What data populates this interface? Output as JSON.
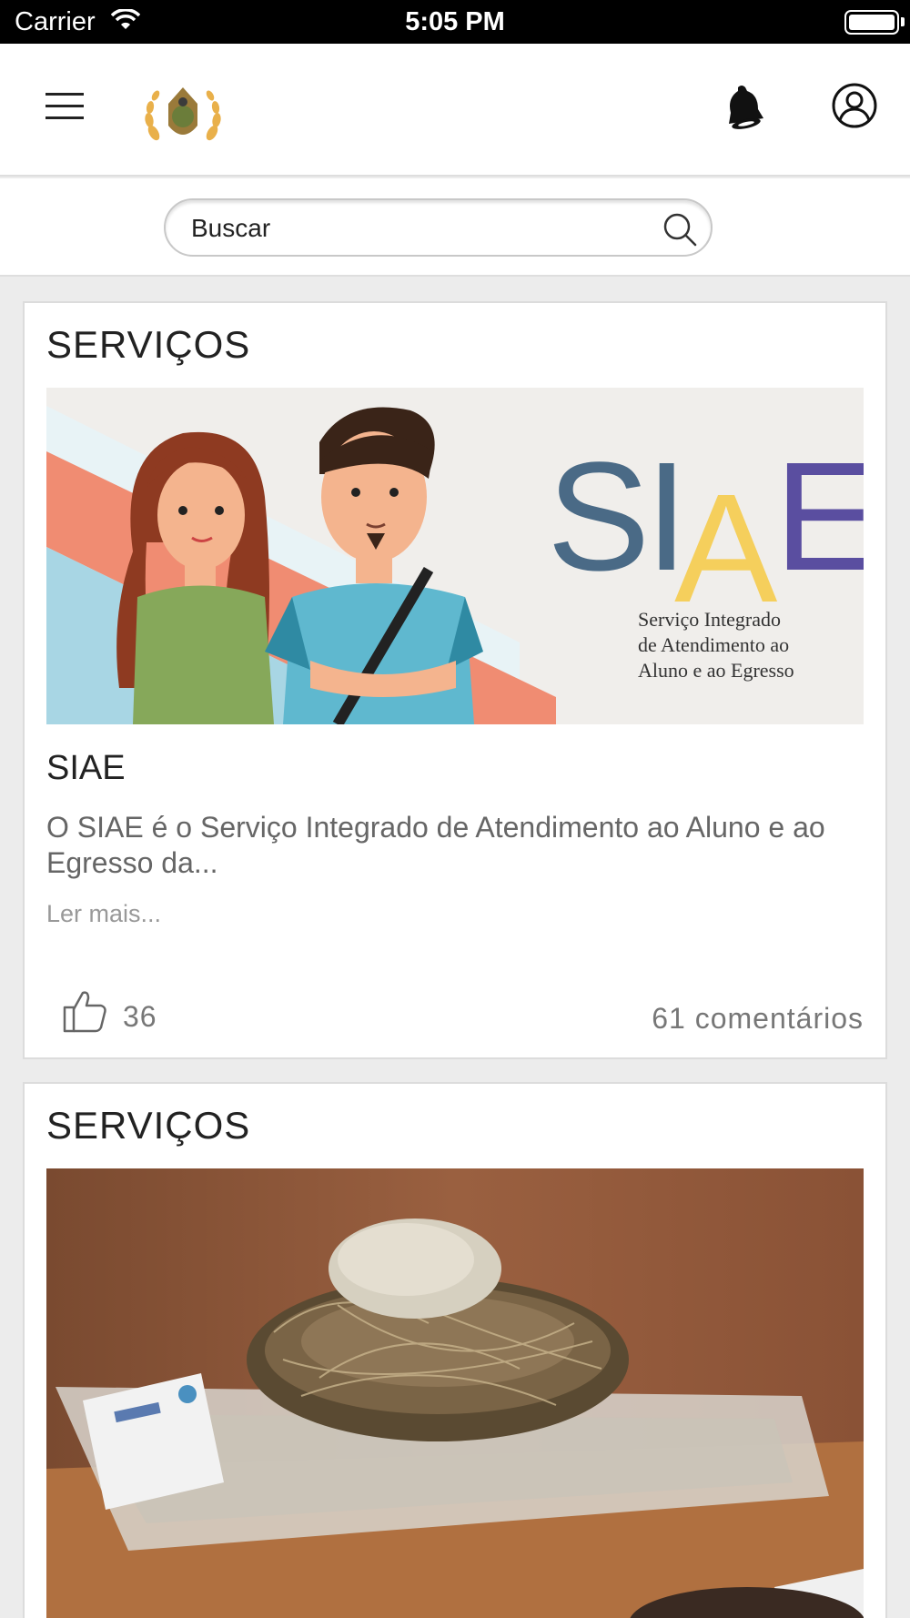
{
  "status_bar": {
    "carrier": "Carrier",
    "time": "5:05 PM",
    "battery_level": 1.0
  },
  "search": {
    "placeholder": "Buscar"
  },
  "feed": [
    {
      "category": "SERVIÇOS",
      "image": {
        "brand_text": "SIAE",
        "tagline_lines": [
          "Serviço Integrado",
          "de Atendimento ao",
          "Aluno e ao Egresso"
        ]
      },
      "title": "SIAE",
      "excerpt": "O SIAE é o Serviço Integrado de Atendimento ao Aluno e ao Egresso da...",
      "read_more": "Ler mais...",
      "likes": "36",
      "comments": "61 comentários"
    },
    {
      "category": "SERVIÇOS"
    }
  ],
  "colors": {
    "siae_s": "#4a6a86",
    "siae_i": "#4a6a86",
    "siae_a": "#f5cf5c",
    "siae_e": "#5a4ea0",
    "header_bg": "#ffffff",
    "page_bg": "#ececec"
  },
  "icons": [
    "hamburger-menu-icon",
    "university-logo",
    "bell-icon",
    "user-profile-icon",
    "search-icon",
    "thumbs-up-icon",
    "wifi-icon",
    "battery-icon"
  ]
}
